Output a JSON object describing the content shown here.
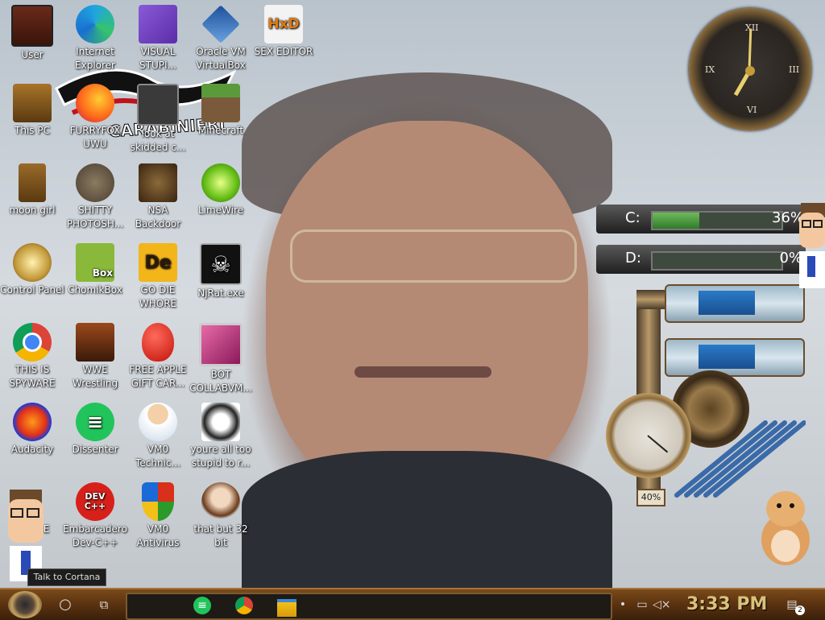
{
  "desktop_icons": [
    {
      "label": "User"
    },
    {
      "label": "Internet Explorer"
    },
    {
      "label": "VISUAL STUPI..."
    },
    {
      "label": "Oracle VM VirtualBox"
    },
    {
      "label": "SEX EDITOR"
    },
    {
      "label": "This PC"
    },
    {
      "label": "FURRYFOX UWU"
    },
    {
      "label": "look at skidded c..."
    },
    {
      "label": "Minecraft"
    },
    {
      "label": "moon girl"
    },
    {
      "label": "SHITTY PHOTOSH..."
    },
    {
      "label": "NSA Backdoor"
    },
    {
      "label": "LimeWire"
    },
    {
      "label": "Control Panel"
    },
    {
      "label": "ChomikBox"
    },
    {
      "label": "GO DIE WHORE"
    },
    {
      "label": "NjRat.exe"
    },
    {
      "label": "THIS IS SPYWARE"
    },
    {
      "label": "WWE Wrestling"
    },
    {
      "label": "FREE APPLE GIFT CAR..."
    },
    {
      "label": "BOT COLLABVM..."
    },
    {
      "label": "Audacity"
    },
    {
      "label": "Dissenter"
    },
    {
      "label": "VM0 Technic..."
    },
    {
      "label": "youre all too stupid to r..."
    },
    {
      "label": "U...ALE"
    },
    {
      "label": "Embarcadero Dev-C++"
    },
    {
      "label": "VM0 Antivirus"
    },
    {
      "label": "that but 32 bit"
    }
  ],
  "icon_glyphs": {
    "hxd": "HxD",
    "devcpp": "DEV C++",
    "chomik_box": "Box",
    "godie": "De"
  },
  "wallpaper": {
    "logo_text": "CARABINIERI"
  },
  "widgets": {
    "drives": [
      {
        "letter": "C:",
        "percent": "36%",
        "fill": 0.36
      },
      {
        "letter": "D:",
        "percent": "0%",
        "fill": 0.0
      }
    ],
    "gauge_value": "40%"
  },
  "cortana_tooltip": "Talk to Cortana",
  "taskbar": {
    "clock": "3:33 PM",
    "notification_count": "2"
  },
  "colors": {
    "taskbar": "#5a3210",
    "clock_text": "#d9c27a",
    "drive_fill": "#4f9a42"
  }
}
